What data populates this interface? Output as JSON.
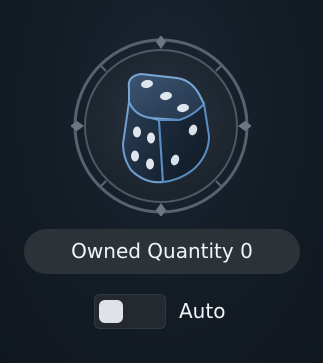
{
  "item": {
    "icon": "dice-icon",
    "owned_label": "Owned Quantity 0"
  },
  "auto": {
    "label": "Auto",
    "enabled": false
  },
  "colors": {
    "background": "#131c26",
    "pill": "#2b3339",
    "text": "#f2f4f6",
    "dice_body": "#283c54",
    "dice_edge": "#6f9fd0"
  }
}
